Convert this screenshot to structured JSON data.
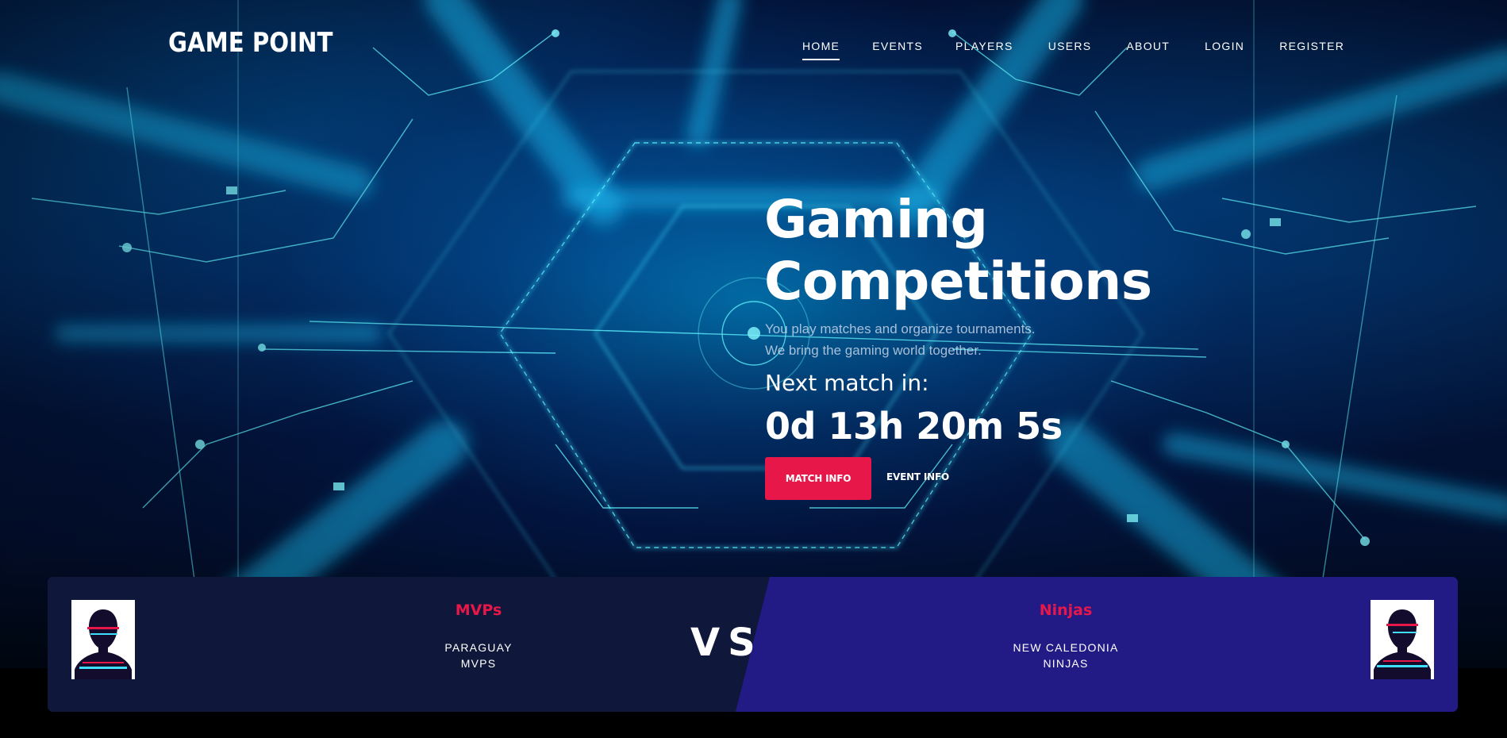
{
  "header": {
    "logo": "GAME POINT",
    "nav": [
      {
        "label": "HOME",
        "active": true
      },
      {
        "label": "EVENTS",
        "active": false
      },
      {
        "label": "PLAYERS",
        "active": false
      },
      {
        "label": "USERS",
        "active": false
      },
      {
        "label": "ABOUT",
        "active": false
      },
      {
        "label": "LOGIN",
        "active": false
      },
      {
        "label": "REGISTER",
        "active": false
      }
    ]
  },
  "hero": {
    "title_line1": "Gaming",
    "title_line2": "Competitions",
    "subtitle_line1": "You play matches and organize tournaments.",
    "subtitle_line2": "We bring the gaming world together.",
    "next_label": "Next match in:",
    "countdown": "0d 13h 20m 5s",
    "match_info_label": "MATCH INFO",
    "event_info_label": "EVENT INFO"
  },
  "match": {
    "vs": "VS",
    "team1": {
      "name": "MVPs",
      "line1": "PARAGUAY",
      "line2": "MVPS"
    },
    "team2": {
      "name": "Ninjas",
      "line1": "NEW CALEDONIA",
      "line2": "NINJAS"
    }
  },
  "colors": {
    "accent": "#e8174a",
    "card_left": "#0f183b",
    "card_right": "#221b86"
  }
}
